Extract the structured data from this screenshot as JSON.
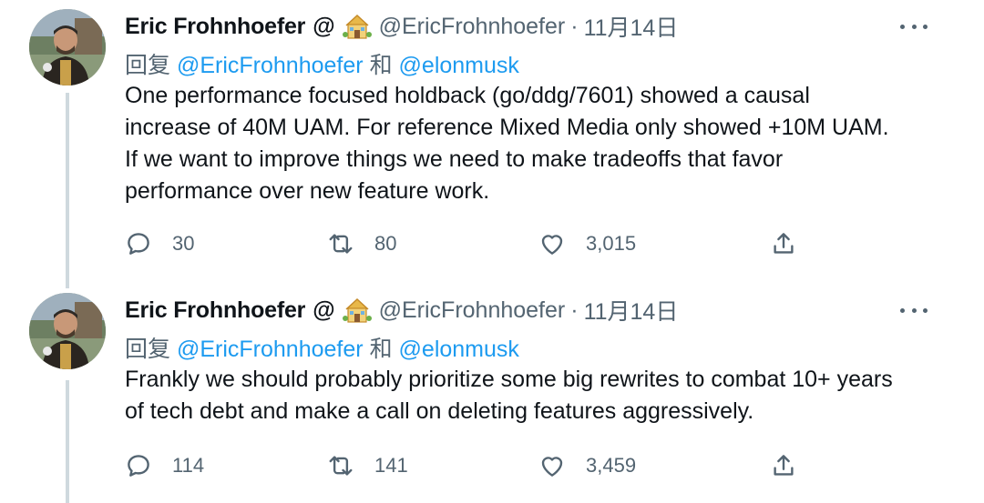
{
  "tweets": [
    {
      "display_name": "Eric Frohnhoefer",
      "at_sign": "@",
      "handle": "@EricFrohnhoefer",
      "separator": "·",
      "date": "11月14日",
      "reply_prefix": "回复",
      "reply_to_1": "@EricFrohnhoefer",
      "reply_conjunction": "和",
      "reply_to_2": "@elonmusk",
      "body_lines": [
        "One performance focused holdback (go/ddg/7601) showed a causal",
        "increase of 40M UAM. For reference Mixed Media only showed +10M UAM.",
        "If we want to improve things we need to make tradeoffs that favor",
        "performance over new feature work."
      ],
      "replies": "30",
      "retweets": "80",
      "likes": "3,015"
    },
    {
      "display_name": "Eric Frohnhoefer",
      "at_sign": "@",
      "handle": "@EricFrohnhoefer",
      "separator": "·",
      "date": "11月14日",
      "reply_prefix": "回复",
      "reply_to_1": "@EricFrohnhoefer",
      "reply_conjunction": "和",
      "reply_to_2": "@elonmusk",
      "body_lines": [
        "Frankly we should probably prioritize some big rewrites to combat 10+ years",
        "of tech debt and make a call on deleting features aggressively."
      ],
      "replies": "114",
      "retweets": "141",
      "likes": "3,459"
    }
  ],
  "icons": {
    "reply": "speech-bubble-icon",
    "retweet": "retweet-icon",
    "like": "heart-icon",
    "share": "share-icon",
    "more": "more-icon",
    "house": "house-emoji-icon"
  },
  "colors": {
    "text": "#0f1419",
    "secondary": "#536471",
    "mention": "#1d9bf0",
    "thread_line": "#cfd9de"
  }
}
